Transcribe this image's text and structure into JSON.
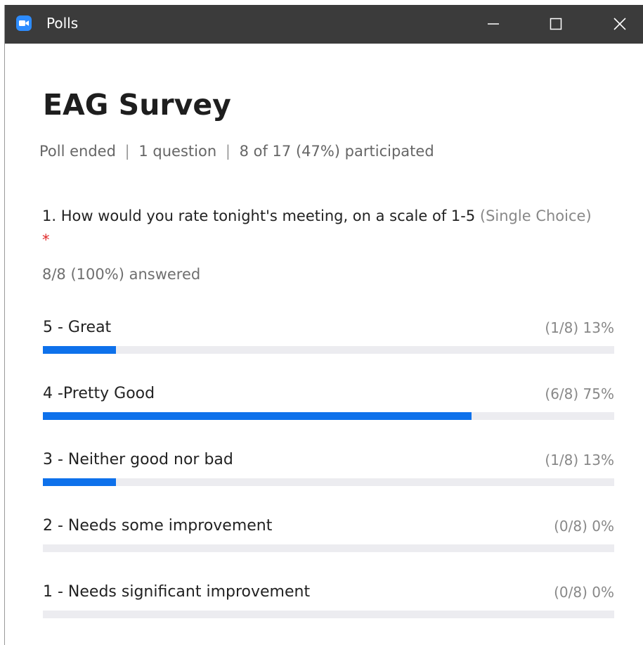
{
  "window": {
    "title": "Polls",
    "app_icon": "zoom-camera-icon",
    "accent_color": "#2d8cff"
  },
  "poll": {
    "title": "EAG Survey",
    "status": "Poll ended",
    "question_count": "1 question",
    "participation": "8 of 17 (47%) participated",
    "separator": "|"
  },
  "question": {
    "text": "1. How would you rate tonight's meeting, on a scale of 1-5",
    "type": "(Single Choice)",
    "required_marker": "*",
    "answered": "8/8 (100%) answered"
  },
  "options": [
    {
      "label": "5 - Great",
      "stat": "(1/8) 13%",
      "fraction": 0.128
    },
    {
      "label": "4 -Pretty Good",
      "stat": "(6/8) 75%",
      "fraction": 0.75
    },
    {
      "label": "3 - Neither good nor bad",
      "stat": "(1/8) 13%",
      "fraction": 0.128
    },
    {
      "label": "2 - Needs some improvement",
      "stat": "(0/8) 0%",
      "fraction": 0
    },
    {
      "label": "1 - Needs significant improvement",
      "stat": "(0/8) 0%",
      "fraction": 0
    }
  ],
  "colors": {
    "bar_fill": "#0e71eb",
    "bar_track": "#ececf0",
    "titlebar": "#3b3b3b"
  }
}
